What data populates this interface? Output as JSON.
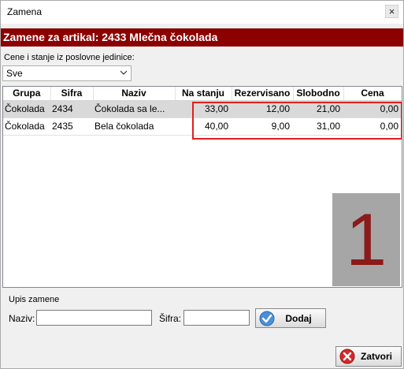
{
  "window": {
    "title": "Zamena",
    "close_glyph": "×"
  },
  "header": {
    "title": "Zamene za artikal: 2433 Mlečna čokolada"
  },
  "filter": {
    "label": "Cene i stanje iz poslovne jedinice:",
    "selected": "Sve"
  },
  "grid": {
    "columns": [
      "Grupa",
      "Sifra",
      "Naziv",
      "Na stanju",
      "Rezervisano",
      "Slobodno",
      "Cena"
    ],
    "rows": [
      [
        "Čokolada",
        "2434",
        "Čokolada sa le...",
        "33,00",
        "12,00",
        "21,00",
        "0,00"
      ],
      [
        "Čokolada",
        "2435",
        "Bela čokolada",
        "40,00",
        "9,00",
        "31,00",
        "0,00"
      ]
    ],
    "selected_row": 0
  },
  "annotation": {
    "badge_number": "1",
    "highlight_color": "#e02020"
  },
  "entry": {
    "section_label": "Upis zamene",
    "naziv_label": "Naziv:",
    "naziv_value": "",
    "sifra_label": "Šifra:",
    "sifra_value": "",
    "add_button": "Dodaj",
    "add_icon": "checkmark-icon"
  },
  "footer": {
    "close_button": "Zatvori",
    "close_icon": "close-circle-icon"
  },
  "colors": {
    "header_band": "#8b0000",
    "selected_row": "#d9d9d9"
  }
}
